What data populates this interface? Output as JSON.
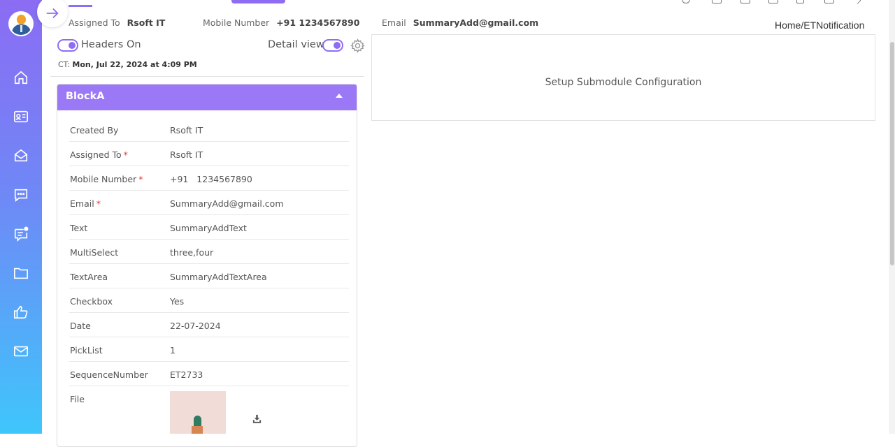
{
  "sidebar": {
    "icons": [
      "home-icon",
      "contact-card-icon",
      "mail-open-icon",
      "chat-icon",
      "notification-chat-icon",
      "folder-icon",
      "thumbs-up-icon",
      "mail-icon"
    ]
  },
  "info": {
    "assigned_label": "Assigned To",
    "assigned_value": "Rsoft  IT",
    "mobile_label": "Mobile Number",
    "mobile_value": "+91 1234567890",
    "email_label": "Email",
    "email_value": "SummaryAdd@gmail.com"
  },
  "breadcrumb": "Home/ETNotification",
  "toggles": {
    "headers_label": "Headers On",
    "detail_label": "Detail view"
  },
  "ct": {
    "prefix": "CT:",
    "value": "Mon, Jul 22, 2024 at 4:09 PM"
  },
  "block": {
    "title": "BlockA",
    "fields": [
      {
        "label": "Created By",
        "value": "Rsoft IT",
        "required": false
      },
      {
        "label": "Assigned To",
        "value": "Rsoft IT",
        "required": true
      },
      {
        "label": "Mobile Number",
        "value": "+91   1234567890",
        "required": true
      },
      {
        "label": "Email",
        "value": "SummaryAdd@gmail.com",
        "required": true
      },
      {
        "label": "Text",
        "value": "SummaryAddText",
        "required": false
      },
      {
        "label": "MultiSelect",
        "value": "three,four",
        "required": false
      },
      {
        "label": "TextArea",
        "value": "SummaryAddTextArea",
        "required": false
      },
      {
        "label": "Checkbox",
        "value": "Yes",
        "required": false
      },
      {
        "label": "Date",
        "value": "22-07-2024",
        "required": false
      },
      {
        "label": "PickList",
        "value": "1",
        "required": false
      },
      {
        "label": "SequenceNumber",
        "value": "ET2733",
        "required": false
      },
      {
        "label": "File",
        "value": "",
        "required": false
      }
    ],
    "required_marker": "*"
  },
  "setup": {
    "text": "Setup Submodule Configuration"
  },
  "colors": {
    "accent": "#8e6cf4",
    "block_header": "#9a78f6",
    "sidebar_top": "#8b6cf3",
    "sidebar_bottom": "#3fc6fb"
  }
}
